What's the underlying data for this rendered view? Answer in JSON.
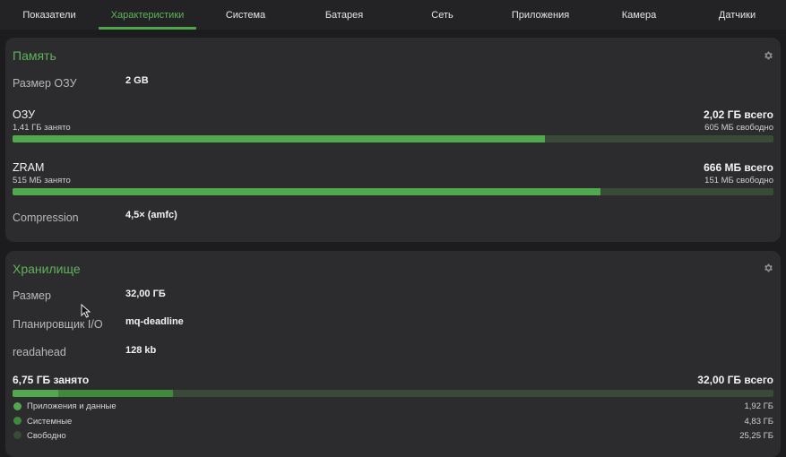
{
  "tabs": [
    {
      "label": "Показатели"
    },
    {
      "label": "Характеристики"
    },
    {
      "label": "Система"
    },
    {
      "label": "Батарея"
    },
    {
      "label": "Сеть"
    },
    {
      "label": "Приложения"
    },
    {
      "label": "Камера"
    },
    {
      "label": "Датчики"
    }
  ],
  "active_tab": "Характеристики",
  "memory": {
    "title": "Память",
    "ram_size_label": "Размер ОЗУ",
    "ram_size_value": "2 GB",
    "ram": {
      "title": "ОЗУ",
      "total": "2,02 ГБ всего",
      "used": "1,41 ГБ занято",
      "free": "605 МБ свободно",
      "fraction": 0.7
    },
    "zram": {
      "title": "ZRAM",
      "total": "666 МБ всего",
      "used": "515 МБ занято",
      "free": "151 МБ свободно",
      "fraction": 0.773
    },
    "compression_label": "Compression",
    "compression_value": "4,5× (amfc)"
  },
  "storage": {
    "title": "Хранилище",
    "size_label": "Размер",
    "size_value": "32,00 ГБ",
    "scheduler_label": "Планировщик I/O",
    "scheduler_value": "mq-deadline",
    "readahead_label": "readahead",
    "readahead_value": "128 kb",
    "used": "6,75 ГБ занято",
    "total": "32,00 ГБ всего",
    "segments": [
      {
        "label": "Приложения и данные",
        "value": "1,92 ГБ",
        "fraction": 0.06,
        "color": "#52a84e"
      },
      {
        "label": "Системные",
        "value": "4,83 ГБ",
        "fraction": 0.151,
        "color": "#3d8a3a"
      },
      {
        "label": "Свободно",
        "value": "25,25 ГБ",
        "fraction": 0.789,
        "color": "#394a39"
      }
    ]
  },
  "colors": {
    "accent": "#5fb35a",
    "bar_fill": "#52a84e",
    "bar_track": "#394a39",
    "card": "#2c2c2e",
    "background": "#1c1c1e"
  }
}
